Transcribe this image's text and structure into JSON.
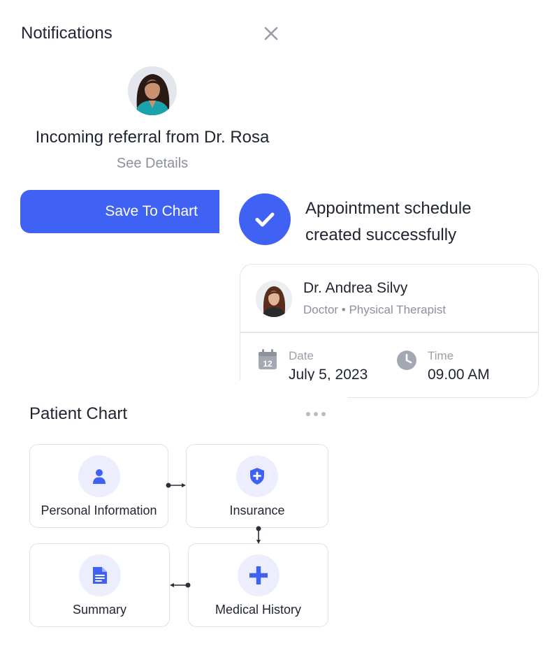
{
  "notifications": {
    "title": "Notifications",
    "close_icon": "close-icon"
  },
  "referral": {
    "title": "Incoming referral from Dr. Rosa",
    "see_details": "See Details",
    "save_button": "Save To Chart"
  },
  "appointment": {
    "line1": "Appointment schedule",
    "line2": "created successfully",
    "status_icon": "check-icon"
  },
  "doctor_card": {
    "name": "Dr. Andrea Silvy",
    "subtitle": "Doctor • Physical Therapist",
    "date_label": "Date",
    "date_value": "July 5, 2023",
    "date_icon_day": "12",
    "time_label": "Time",
    "time_value": "09.00 AM"
  },
  "patient_chart": {
    "title": "Patient Chart",
    "tiles": [
      {
        "label": "Personal Information",
        "icon": "person-icon"
      },
      {
        "label": "Insurance",
        "icon": "shield-icon"
      },
      {
        "label": "Summary",
        "icon": "document-icon"
      },
      {
        "label": "Medical History",
        "icon": "plus-icon"
      }
    ]
  },
  "colors": {
    "accent": "#4062f4",
    "icon_bg": "#eceefe",
    "muted_text": "#8b909b",
    "border": "#e1e4ea"
  }
}
